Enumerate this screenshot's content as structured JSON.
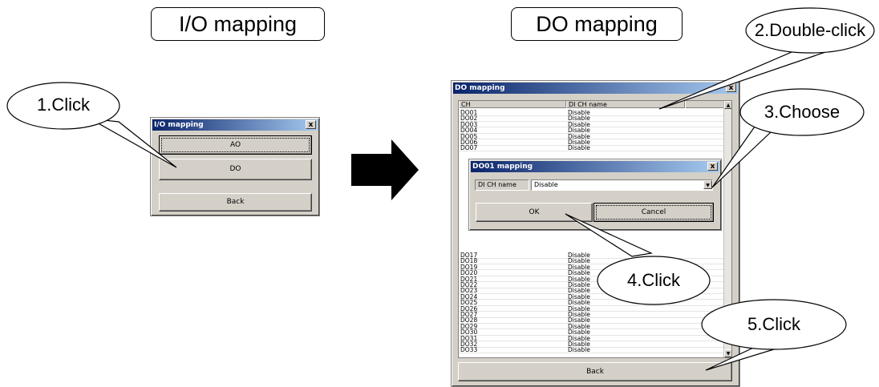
{
  "headings": {
    "io_mapping": "I/O mapping",
    "do_mapping": "DO mapping"
  },
  "callouts": {
    "step1": "1.Click",
    "step2": "2.Double-click",
    "step3": "3.Choose",
    "step4": "4.Click",
    "step5": "5.Click"
  },
  "io_dialog": {
    "title": "I/O mapping",
    "buttons": {
      "ao": "AO",
      "do": "DO",
      "back": "Back"
    }
  },
  "do_dialog": {
    "title": "DO mapping",
    "columns": {
      "ch": "CH",
      "name": "DI CH name"
    },
    "rows_top": [
      {
        "ch": "DO01",
        "name": "Disable"
      },
      {
        "ch": "DO02",
        "name": "Disable"
      },
      {
        "ch": "DO03",
        "name": "Disable"
      },
      {
        "ch": "DO04",
        "name": "Disable"
      },
      {
        "ch": "DO05",
        "name": "Disable"
      },
      {
        "ch": "DO06",
        "name": "Disable"
      },
      {
        "ch": "DO07",
        "name": "Disable"
      }
    ],
    "rows_bottom": [
      {
        "ch": "DO17",
        "name": "Disable"
      },
      {
        "ch": "DO18",
        "name": "Disable"
      },
      {
        "ch": "DO19",
        "name": "Disable"
      },
      {
        "ch": "DO20",
        "name": "Disable"
      },
      {
        "ch": "DO21",
        "name": "Disable"
      },
      {
        "ch": "DO22",
        "name": "Disable"
      },
      {
        "ch": "DO23",
        "name": "Disable"
      },
      {
        "ch": "DO24",
        "name": "Disable"
      },
      {
        "ch": "DO25",
        "name": "Disable"
      },
      {
        "ch": "DO26",
        "name": "Disable"
      },
      {
        "ch": "DO27",
        "name": "Disable"
      },
      {
        "ch": "DO28",
        "name": "Disable"
      },
      {
        "ch": "DO29",
        "name": "Disable"
      },
      {
        "ch": "DO30",
        "name": "Disable"
      },
      {
        "ch": "DO31",
        "name": "Disable"
      },
      {
        "ch": "DO32",
        "name": "Disable"
      },
      {
        "ch": "DO33",
        "name": "Disable"
      }
    ],
    "back_label": "Back",
    "close_label": "x"
  },
  "do01_dialog": {
    "title": "DO01 mapping",
    "field_label": "DI CH name",
    "field_value": "Disable",
    "ok_label": "OK",
    "cancel_label": "Cancel"
  },
  "icons": {
    "close": "close-icon",
    "dropdown": "chevron-down-icon",
    "scroll_up": "scroll-up-icon",
    "scroll_down": "scroll-down-icon",
    "flow_arrow": "arrow-right-icon"
  }
}
